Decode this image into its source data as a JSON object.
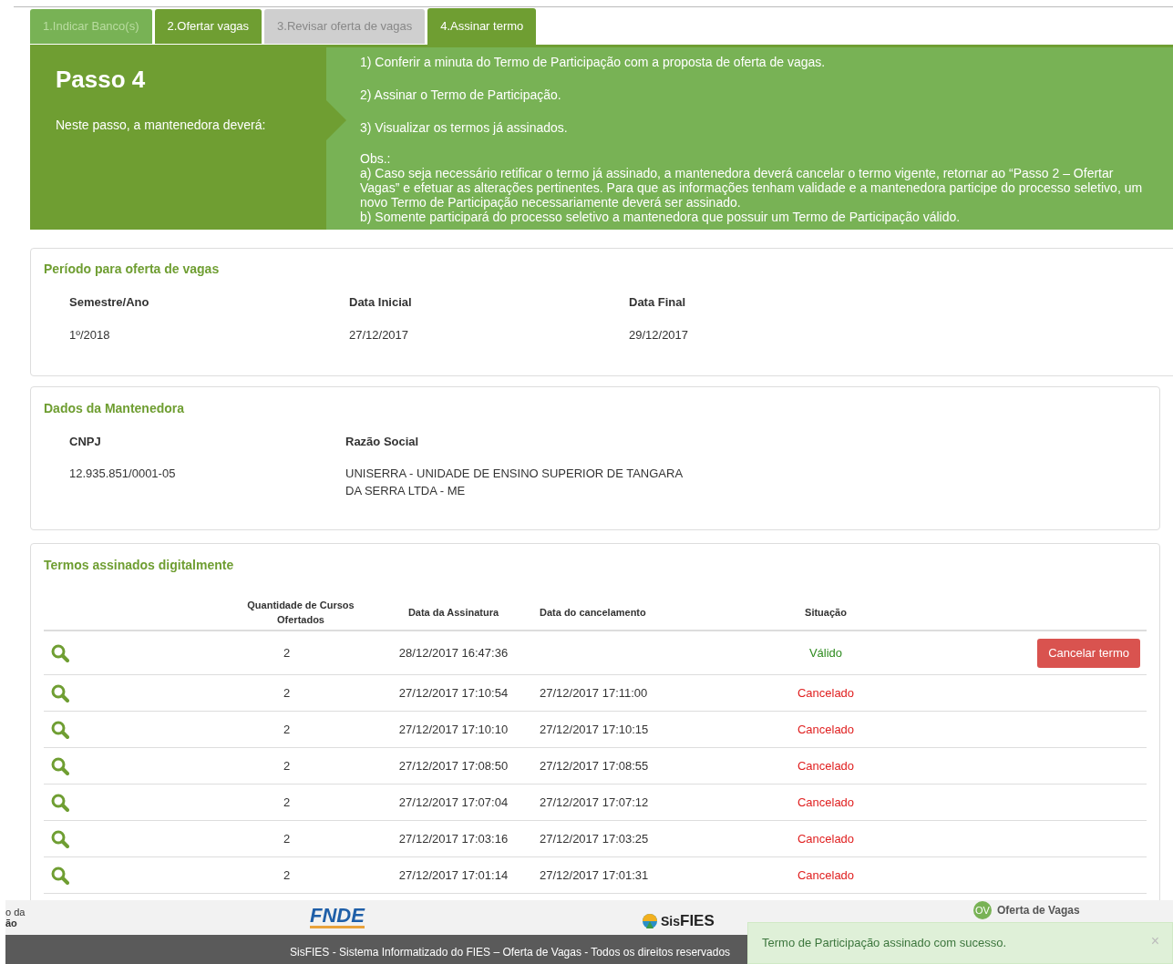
{
  "tabs": [
    {
      "label": "1.Indicar Banco(s)",
      "kind": "done",
      "selected": false
    },
    {
      "label": "2.Ofertar vagas",
      "kind": "open",
      "selected": false
    },
    {
      "label": "3.Revisar oferta de vagas",
      "kind": "locked",
      "selected": false
    },
    {
      "label": "4.Assinar termo",
      "kind": "open",
      "selected": true
    }
  ],
  "step": {
    "title": "Passo 4",
    "intro": "Neste passo, a mantenedora deverá:",
    "items": [
      "1) Conferir a minuta do Termo de Participação com a proposta de oferta de vagas.",
      "2) Assinar o Termo de Participação.",
      "3) Visualizar os termos já assinados."
    ],
    "obs_title": "Obs.:",
    "obs": [
      "a) Caso seja necessário retificar o termo já assinado, a mantenedora deverá cancelar o termo vigente, retornar ao “Passo 2 – Ofertar Vagas” e efetuar as alterações pertinentes. Para que as informações tenham validade e a mantenedora participe do processo seletivo, um novo Termo de Participação necessariamente deverá ser assinado.",
      "b) Somente participará do processo seletivo a mantenedora que possuir um Termo de Participação válido."
    ]
  },
  "period": {
    "title": "Período para oferta de vagas",
    "columns": [
      "Semestre/Ano",
      "Data Inicial",
      "Data Final"
    ],
    "values": [
      "1º/2018",
      "27/12/2017",
      "29/12/2017"
    ]
  },
  "sponsor": {
    "title": "Dados da Mantenedora",
    "columns": [
      "CNPJ",
      "Razão Social"
    ],
    "values": [
      "12.935.851/0001-05",
      "UNISERRA - UNIDADE DE ENSINO SUPERIOR DE TANGARA DA SERRA LTDA - ME"
    ]
  },
  "terms": {
    "title": "Termos assinados digitalmente",
    "columns": [
      "Quantidade de Cursos Ofertados",
      "Data da Assinatura",
      "Data do cancelamento",
      "Situação"
    ],
    "rows": [
      {
        "quantity": "2",
        "signed": "28/12/2017 16:47:36",
        "status": "Válido",
        "kind": "valid",
        "action": "Cancelar termo"
      },
      {
        "quantity": "2",
        "signed": "27/12/2017 17:10:54",
        "cancelled": "27/12/2017 17:11:00",
        "status": "Cancelado",
        "kind": "cancelled"
      },
      {
        "quantity": "2",
        "signed": "27/12/2017 17:10:10",
        "cancelled": "27/12/2017 17:10:15",
        "status": "Cancelado",
        "kind": "cancelled"
      },
      {
        "quantity": "2",
        "signed": "27/12/2017 17:08:50",
        "cancelled": "27/12/2017 17:08:55",
        "status": "Cancelado",
        "kind": "cancelled"
      },
      {
        "quantity": "2",
        "signed": "27/12/2017 17:07:04",
        "cancelled": "27/12/2017 17:07:12",
        "status": "Cancelado",
        "kind": "cancelled"
      },
      {
        "quantity": "2",
        "signed": "27/12/2017 17:03:16",
        "cancelled": "27/12/2017 17:03:25",
        "status": "Cancelado",
        "kind": "cancelled"
      },
      {
        "quantity": "2",
        "signed": "27/12/2017 17:01:14",
        "cancelled": "27/12/2017 17:01:31",
        "status": "Cancelado",
        "kind": "cancelled"
      }
    ]
  },
  "footer": {
    "cut_logo": [
      "o da",
      "ão"
    ],
    "fnde": "FNDE",
    "sisfies": [
      "Sis",
      "FIES"
    ],
    "ov_badge": "OV",
    "ov_label": "Oferta de Vagas",
    "copyright": "SisFIES - Sistema Informatizado do FIES – Oferta de Vagas - Todos os direitos reservados"
  },
  "toast": {
    "message": "Termo de Participação assinado com sucesso.",
    "close": "×"
  }
}
